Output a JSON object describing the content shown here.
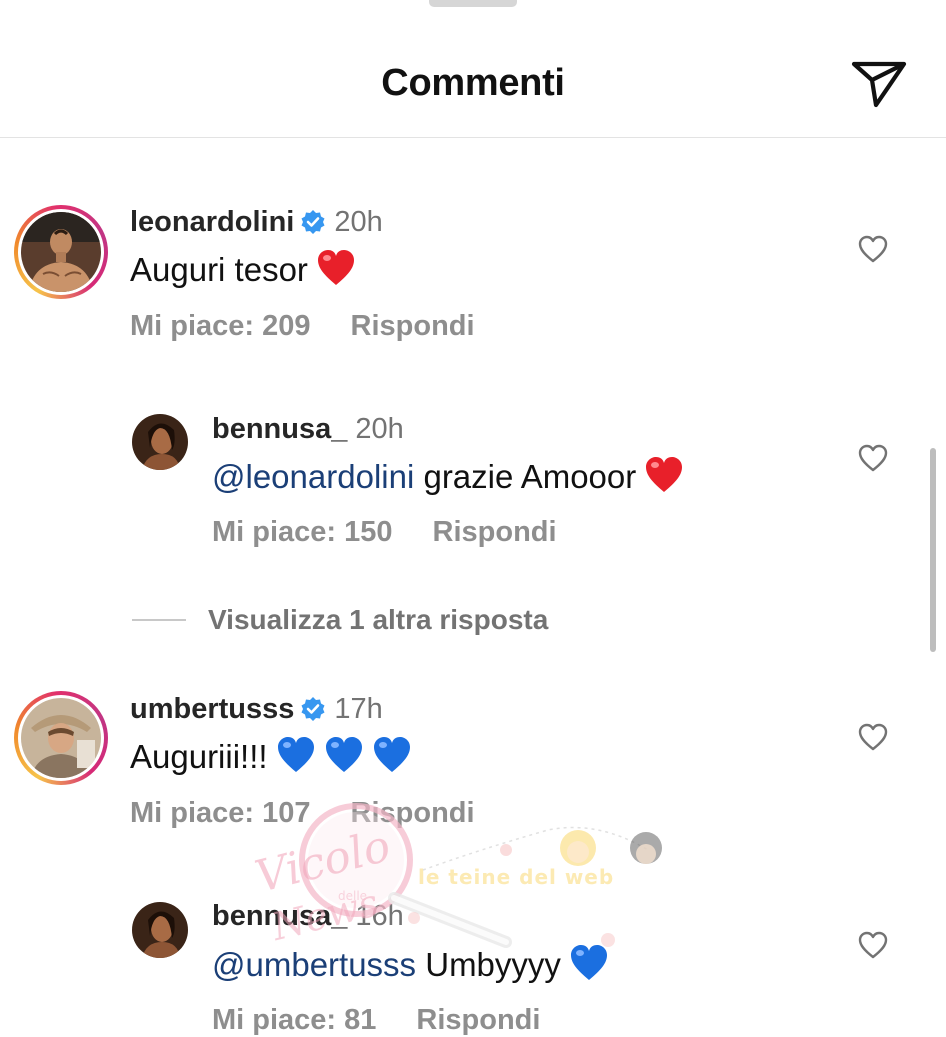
{
  "header": {
    "title": "Commenti",
    "share_icon": "paper-plane-icon"
  },
  "colors": {
    "mention": "#1b3f77",
    "meta_gray": "#8e8e8e",
    "verified_blue": "#3797f0",
    "heart_red": "#e8202a",
    "heart_blue": "#1b6fe0"
  },
  "comments": [
    {
      "username": "leonardolini",
      "verified": true,
      "time": "20h",
      "text": "Auguri tesor",
      "emojis": [
        "red-heart"
      ],
      "likes_label": "Mi piace: 209",
      "reply_label": "Rispondi",
      "replies": [
        {
          "username": "bennusa_",
          "verified": false,
          "time": "20h",
          "mention": "@leonardolini",
          "text": " grazie Amooor",
          "emojis": [
            "red-heart"
          ],
          "likes_label": "Mi piace: 150",
          "reply_label": "Rispondi"
        }
      ],
      "view_more_label": "Visualizza 1 altra risposta"
    },
    {
      "username": "umbertusss",
      "verified": true,
      "time": "17h",
      "text": "Auguriii!!!",
      "emojis": [
        "blue-heart",
        "blue-heart",
        "blue-heart"
      ],
      "likes_label": "Mi piace: 107",
      "reply_label": "Rispondi",
      "replies": [
        {
          "username": "bennusa_",
          "verified": false,
          "time": "16h",
          "mention": "@umbertusss",
          "text": " Umbyyyy",
          "emojis": [
            "blue-heart"
          ],
          "likes_label": "Mi piace: 81",
          "reply_label": "Rispondi"
        }
      ]
    }
  ],
  "watermark": {
    "brand": "Vicolo delle News",
    "tagline": "le teine del web"
  }
}
